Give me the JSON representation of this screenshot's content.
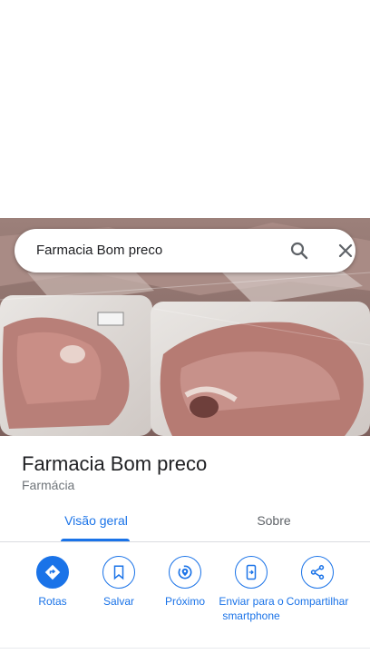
{
  "search": {
    "query": "Farmacia Bom preco"
  },
  "place": {
    "name": "Farmacia Bom preco",
    "category": "Farmácia"
  },
  "tabs": [
    {
      "label": "Visão geral",
      "active": true
    },
    {
      "label": "Sobre",
      "active": false
    }
  ],
  "actions": [
    {
      "label": "Rotas",
      "icon": "directions-icon"
    },
    {
      "label": "Salvar",
      "icon": "bookmark-icon"
    },
    {
      "label": "Próximo",
      "icon": "nearby-icon"
    },
    {
      "label": "Enviar para o smartphone",
      "icon": "send-to-phone-icon"
    },
    {
      "label": "Compartilhar",
      "icon": "share-icon"
    }
  ],
  "colors": {
    "accent": "#1a73e8",
    "secondary_text": "#70757a"
  }
}
